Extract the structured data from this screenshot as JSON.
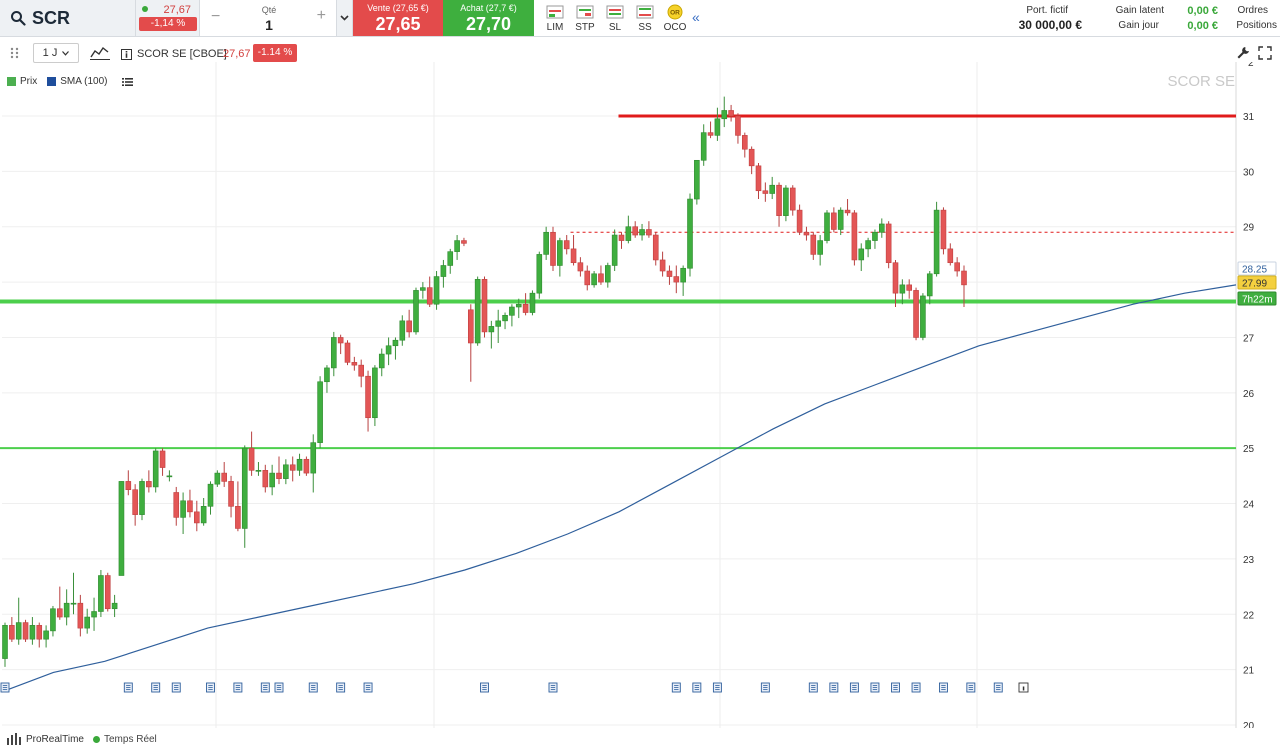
{
  "topbar": {
    "symbol": "SCR",
    "last_price": "27,67",
    "change_pct": "-1,14 %",
    "qty_label": "Qté",
    "qty_value": "1",
    "sell_title": "Vente (27,65 €)",
    "sell_price": "27,65",
    "buy_title": "Achat (27,7 €)",
    "buy_price": "27,70",
    "order_types": [
      {
        "label": "LIM",
        "icon": "limit-order-icon"
      },
      {
        "label": "STP",
        "icon": "stop-order-icon"
      },
      {
        "label": "SL",
        "icon": "stop-limit-icon"
      },
      {
        "label": "SS",
        "icon": "trailing-stop-icon"
      },
      {
        "label": "OCO",
        "icon": "oco-order-icon",
        "badge": "OR"
      }
    ],
    "portfolio_label": "Port. fictif",
    "portfolio_value": "30 000,00 €",
    "unrealized_label": "Gain latent",
    "unrealized_value": "0,00 €",
    "daily_label": "Gain jour",
    "daily_value": "0,00 €",
    "orders_label": "Ordres",
    "positions_label": "Positions"
  },
  "chart_header": {
    "period": "1 J",
    "name": "SCOR SE [CBOE]",
    "price": "27,67",
    "change": "-1.14 %"
  },
  "legend": {
    "price": "Prix",
    "sma": "SMA (100)"
  },
  "watermark": "SCOR SE",
  "footer": {
    "brand": "ProRealTime",
    "realtime": "Temps Réel"
  },
  "colors": {
    "up": "#3fae3f",
    "down": "#e35656",
    "sma": "#2f5f9c",
    "resistance": "#e01b1b",
    "support": "#4ccf4c",
    "price_tag": "#f4d03f",
    "timer_tag": "#3fae3f"
  },
  "chart_data": {
    "type": "candlestick",
    "ylim": [
      20,
      32
    ],
    "yticks": [
      "20",
      "21",
      "22",
      "23",
      "24",
      "25",
      "26",
      "27",
      "28",
      "29",
      "30",
      "31"
    ],
    "y_top_partial_tick": "2",
    "price_tags": [
      "28.25",
      "27.99",
      "7h22m"
    ],
    "hlines": [
      {
        "value": 31.0,
        "style": "solid",
        "color": "#e01b1b",
        "from_bar": 90
      },
      {
        "value": 28.9,
        "style": "dashed",
        "color": "#e01b1b",
        "from_bar": 83
      },
      {
        "value": 27.65,
        "style": "solid-thick",
        "color": "#4ccf4c",
        "from_bar": 0
      },
      {
        "value": 25.0,
        "style": "solid",
        "color": "#4ccf4c",
        "from_bar": 0
      }
    ],
    "candles": [
      [
        21.2,
        21.85,
        21.05,
        21.8
      ],
      [
        21.8,
        21.95,
        21.5,
        21.55
      ],
      [
        21.55,
        22.3,
        21.45,
        21.85
      ],
      [
        21.85,
        21.9,
        21.5,
        21.55
      ],
      [
        21.55,
        21.95,
        21.45,
        21.8
      ],
      [
        21.8,
        21.85,
        21.4,
        21.55
      ],
      [
        21.55,
        21.8,
        21.4,
        21.7
      ],
      [
        21.7,
        22.15,
        21.6,
        22.1
      ],
      [
        22.1,
        22.5,
        21.9,
        21.95
      ],
      [
        21.95,
        22.45,
        21.8,
        22.2
      ],
      [
        22.2,
        22.75,
        22.0,
        22.2
      ],
      [
        22.2,
        22.35,
        21.6,
        21.75
      ],
      [
        21.75,
        22.1,
        21.65,
        21.95
      ],
      [
        21.95,
        22.3,
        21.7,
        22.05
      ],
      [
        22.05,
        22.8,
        21.95,
        22.7
      ],
      [
        22.7,
        22.75,
        22.05,
        22.1
      ],
      [
        22.1,
        22.35,
        21.95,
        22.2
      ],
      [
        22.7,
        24.4,
        23.35,
        24.4
      ],
      [
        24.4,
        24.6,
        24.15,
        24.25
      ],
      [
        24.25,
        24.35,
        23.6,
        23.8
      ],
      [
        23.8,
        24.45,
        23.7,
        24.4
      ],
      [
        24.4,
        24.6,
        24.2,
        24.3
      ],
      [
        24.3,
        25.0,
        24.2,
        24.95
      ],
      [
        24.95,
        25.0,
        24.5,
        24.65
      ],
      [
        24.5,
        24.6,
        24.4,
        24.5
      ],
      [
        24.2,
        24.3,
        23.6,
        23.75
      ],
      [
        23.75,
        24.2,
        23.45,
        24.05
      ],
      [
        24.05,
        24.25,
        23.75,
        23.85
      ],
      [
        23.85,
        24.05,
        23.5,
        23.65
      ],
      [
        23.65,
        24.1,
        23.6,
        23.95
      ],
      [
        23.95,
        24.4,
        23.8,
        24.35
      ],
      [
        24.35,
        24.6,
        24.3,
        24.55
      ],
      [
        24.55,
        24.75,
        24.3,
        24.4
      ],
      [
        24.4,
        24.5,
        23.75,
        23.95
      ],
      [
        23.95,
        24.4,
        23.5,
        23.55
      ],
      [
        23.55,
        25.05,
        23.2,
        25.0
      ],
      [
        25.0,
        25.3,
        24.5,
        24.6
      ],
      [
        24.6,
        24.75,
        24.5,
        24.6
      ],
      [
        24.6,
        24.7,
        24.2,
        24.3
      ],
      [
        24.3,
        24.7,
        24.15,
        24.55
      ],
      [
        24.55,
        24.85,
        24.35,
        24.45
      ],
      [
        24.45,
        24.8,
        24.35,
        24.7
      ],
      [
        24.7,
        24.85,
        24.4,
        24.6
      ],
      [
        24.6,
        24.9,
        24.5,
        24.8
      ],
      [
        24.8,
        24.85,
        24.5,
        24.55
      ],
      [
        24.55,
        25.25,
        24.2,
        25.1
      ],
      [
        25.1,
        26.3,
        25.0,
        26.2
      ],
      [
        26.2,
        26.5,
        26.0,
        26.45
      ],
      [
        26.45,
        27.1,
        26.3,
        27.0
      ],
      [
        27.0,
        27.05,
        26.7,
        26.9
      ],
      [
        26.9,
        26.95,
        26.5,
        26.55
      ],
      [
        26.55,
        26.65,
        26.4,
        26.5
      ],
      [
        26.5,
        26.6,
        26.1,
        26.3
      ],
      [
        26.3,
        26.4,
        25.3,
        25.55
      ],
      [
        25.55,
        26.5,
        25.4,
        26.45
      ],
      [
        26.45,
        26.8,
        26.3,
        26.7
      ],
      [
        26.7,
        27.0,
        26.5,
        26.85
      ],
      [
        26.85,
        27.0,
        26.6,
        26.95
      ],
      [
        26.95,
        27.4,
        26.85,
        27.3
      ],
      [
        27.3,
        27.5,
        27.0,
        27.1
      ],
      [
        27.1,
        27.9,
        27.05,
        27.85
      ],
      [
        27.85,
        28.0,
        27.7,
        27.9
      ],
      [
        27.9,
        28.1,
        27.55,
        27.6
      ],
      [
        27.6,
        28.2,
        27.5,
        28.1
      ],
      [
        28.1,
        28.4,
        27.9,
        28.3
      ],
      [
        28.3,
        28.6,
        28.15,
        28.55
      ],
      [
        28.55,
        28.85,
        28.4,
        28.75
      ],
      [
        28.75,
        28.8,
        28.65,
        28.7
      ],
      [
        27.5,
        27.6,
        26.2,
        26.9
      ],
      [
        26.9,
        28.1,
        26.85,
        28.05
      ],
      [
        28.05,
        28.1,
        27.0,
        27.1
      ],
      [
        27.1,
        27.3,
        26.8,
        27.2
      ],
      [
        27.2,
        27.5,
        26.9,
        27.3
      ],
      [
        27.3,
        27.45,
        27.15,
        27.4
      ],
      [
        27.4,
        27.6,
        27.2,
        27.55
      ],
      [
        27.55,
        27.7,
        27.35,
        27.6
      ],
      [
        27.6,
        27.8,
        27.4,
        27.45
      ],
      [
        27.45,
        27.85,
        27.4,
        27.8
      ],
      [
        27.8,
        28.55,
        27.7,
        28.5
      ],
      [
        28.5,
        29.0,
        28.4,
        28.9
      ],
      [
        28.9,
        29.0,
        28.2,
        28.3
      ],
      [
        28.3,
        28.8,
        28.1,
        28.75
      ],
      [
        28.75,
        28.85,
        28.5,
        28.6
      ],
      [
        28.6,
        28.85,
        28.3,
        28.35
      ],
      [
        28.35,
        28.45,
        28.1,
        28.2
      ],
      [
        28.2,
        28.3,
        27.85,
        27.95
      ],
      [
        27.95,
        28.2,
        27.9,
        28.15
      ],
      [
        28.15,
        28.3,
        27.95,
        28.0
      ],
      [
        28.0,
        28.35,
        27.9,
        28.3
      ],
      [
        28.3,
        28.95,
        28.2,
        28.85
      ],
      [
        28.85,
        28.9,
        28.6,
        28.75
      ],
      [
        28.75,
        29.2,
        28.7,
        29.0
      ],
      [
        29.0,
        29.1,
        28.8,
        28.85
      ],
      [
        28.85,
        29.05,
        28.75,
        28.95
      ],
      [
        28.95,
        29.1,
        28.8,
        28.85
      ],
      [
        28.85,
        28.9,
        28.3,
        28.4
      ],
      [
        28.4,
        28.55,
        28.1,
        28.2
      ],
      [
        28.2,
        28.3,
        27.95,
        28.1
      ],
      [
        28.1,
        28.3,
        27.8,
        28.0
      ],
      [
        28.0,
        28.3,
        27.75,
        28.25
      ],
      [
        28.25,
        29.6,
        28.1,
        29.5
      ],
      [
        29.5,
        30.2,
        29.4,
        30.2
      ],
      [
        30.2,
        30.85,
        30.1,
        30.7
      ],
      [
        30.7,
        30.9,
        30.6,
        30.65
      ],
      [
        30.65,
        31.15,
        30.55,
        30.95
      ],
      [
        30.95,
        31.35,
        30.8,
        31.1
      ],
      [
        31.1,
        31.2,
        30.9,
        31.0
      ],
      [
        31.0,
        31.05,
        30.5,
        30.65
      ],
      [
        30.65,
        30.7,
        30.25,
        30.4
      ],
      [
        30.4,
        30.45,
        29.95,
        30.1
      ],
      [
        30.1,
        30.15,
        29.5,
        29.65
      ],
      [
        29.65,
        29.8,
        29.45,
        29.6
      ],
      [
        29.6,
        29.9,
        29.5,
        29.75
      ],
      [
        29.75,
        29.8,
        29.0,
        29.2
      ],
      [
        29.2,
        29.75,
        29.1,
        29.7
      ],
      [
        29.7,
        29.75,
        29.2,
        29.3
      ],
      [
        29.3,
        29.4,
        28.85,
        28.9
      ],
      [
        28.9,
        29.0,
        28.75,
        28.85
      ],
      [
        28.85,
        28.9,
        28.4,
        28.5
      ],
      [
        28.5,
        28.85,
        28.3,
        28.75
      ],
      [
        28.75,
        29.3,
        28.7,
        29.25
      ],
      [
        29.25,
        29.35,
        28.9,
        28.95
      ],
      [
        28.95,
        29.35,
        28.85,
        29.3
      ],
      [
        29.3,
        29.5,
        29.2,
        29.25
      ],
      [
        29.25,
        29.3,
        28.3,
        28.4
      ],
      [
        28.4,
        28.7,
        28.2,
        28.6
      ],
      [
        28.6,
        28.8,
        28.45,
        28.75
      ],
      [
        28.75,
        28.95,
        28.6,
        28.9
      ],
      [
        28.9,
        29.15,
        28.8,
        29.05
      ],
      [
        29.05,
        29.1,
        28.25,
        28.35
      ],
      [
        28.35,
        28.4,
        27.55,
        27.8
      ],
      [
        27.8,
        28.05,
        27.6,
        27.95
      ],
      [
        27.95,
        28.05,
        27.7,
        27.85
      ],
      [
        27.85,
        27.9,
        26.95,
        27.0
      ],
      [
        27.0,
        27.8,
        26.95,
        27.75
      ],
      [
        27.75,
        28.2,
        27.6,
        28.15
      ],
      [
        28.15,
        29.45,
        28.1,
        29.3
      ],
      [
        29.3,
        29.35,
        28.5,
        28.6
      ],
      [
        28.6,
        28.7,
        28.3,
        28.35
      ],
      [
        28.35,
        28.45,
        28.1,
        28.2
      ],
      [
        28.2,
        28.3,
        27.55,
        27.95
      ]
    ],
    "sma100": [
      [
        0,
        20.6
      ],
      [
        10,
        20.95
      ],
      [
        20,
        21.15
      ],
      [
        30,
        21.45
      ],
      [
        40,
        21.75
      ],
      [
        50,
        21.95
      ],
      [
        60,
        22.15
      ],
      [
        70,
        22.35
      ],
      [
        80,
        22.55
      ],
      [
        90,
        22.8
      ],
      [
        100,
        23.1
      ],
      [
        110,
        23.45
      ],
      [
        120,
        23.85
      ],
      [
        130,
        24.35
      ],
      [
        140,
        24.85
      ],
      [
        150,
        25.35
      ],
      [
        160,
        25.8
      ],
      [
        170,
        26.15
      ],
      [
        180,
        26.5
      ],
      [
        190,
        26.85
      ],
      [
        200,
        27.1
      ],
      [
        210,
        27.35
      ],
      [
        220,
        27.6
      ],
      [
        230,
        27.8
      ],
      [
        240,
        27.95
      ]
    ],
    "event_markers": [
      0,
      18,
      22,
      25,
      30,
      34,
      38,
      40,
      45,
      49,
      53,
      70,
      80,
      98,
      101,
      104,
      111,
      118,
      121,
      124,
      127,
      130,
      133,
      137,
      141,
      145
    ],
    "event_marker_last": "info"
  }
}
